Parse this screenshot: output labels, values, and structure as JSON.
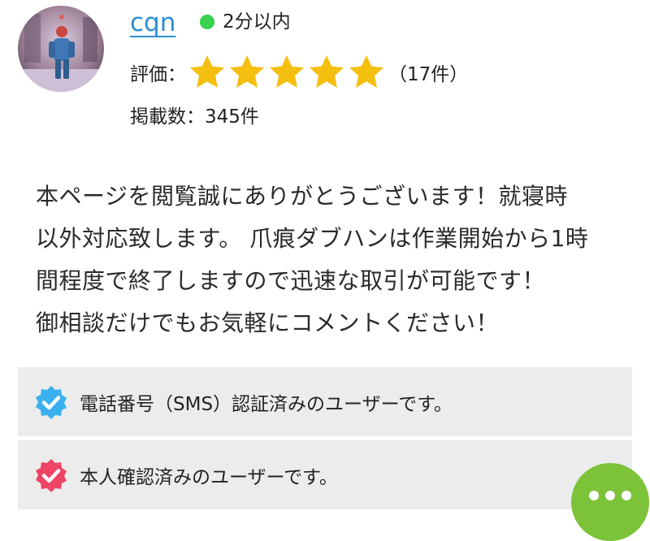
{
  "seller": {
    "username": "cqn",
    "online_status": "2分以内",
    "rating_label": "評価：",
    "rating": 5,
    "rating_max": 5,
    "review_count": "（17件）",
    "listings": "掲載数：345件"
  },
  "bio": {
    "lines": [
      "本ページを閲覧誠にありがとうございます！就寝時",
      "以外対応致します。 爪痕ダブハンは作業開始から1時",
      "間程度で終了しますので迅速な取引が可能です！",
      "御相談だけでもお気軽にコメントください！"
    ]
  },
  "badges": {
    "phone": "電話番号（SMS）認証済みのユーザーです。",
    "identity": "本人確認済みのユーザーです。"
  },
  "colors": {
    "link": "#2b8fd2",
    "online": "#35d24a",
    "star": "#f5bf0f",
    "phone_badge": "#3ab0ef",
    "identity_badge": "#ee4466",
    "fab": "#7cc33a",
    "badge_bg": "#ececec"
  },
  "icons": {
    "online": "online-status-dot",
    "phone_badge": "verified-check-icon",
    "identity_badge": "verified-check-icon",
    "fab": "more-dots-icon"
  }
}
